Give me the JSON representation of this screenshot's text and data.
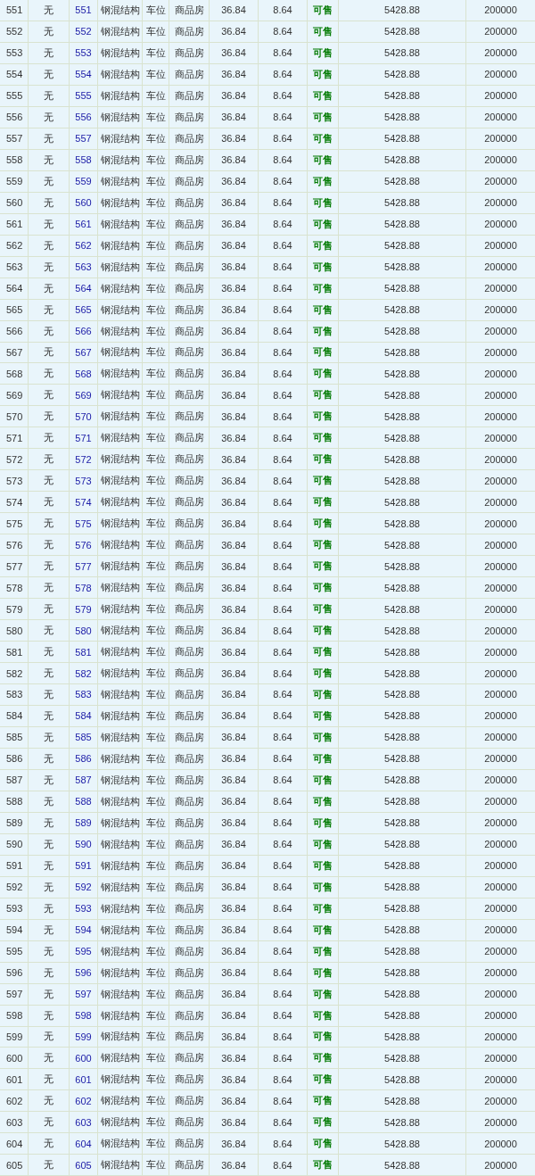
{
  "table": {
    "rows": [
      [
        "551",
        "无",
        "551",
        "钢混结构",
        "车位",
        "商品房",
        "36.84",
        "8.64",
        "可售",
        "5428.88",
        "200000"
      ],
      [
        "552",
        "无",
        "552",
        "钢混结构",
        "车位",
        "商品房",
        "36.84",
        "8.64",
        "可售",
        "5428.88",
        "200000"
      ],
      [
        "553",
        "无",
        "553",
        "钢混结构",
        "车位",
        "商品房",
        "36.84",
        "8.64",
        "可售",
        "5428.88",
        "200000"
      ],
      [
        "554",
        "无",
        "554",
        "钢混结构",
        "车位",
        "商品房",
        "36.84",
        "8.64",
        "可售",
        "5428.88",
        "200000"
      ],
      [
        "555",
        "无",
        "555",
        "钢混结构",
        "车位",
        "商品房",
        "36.84",
        "8.64",
        "可售",
        "5428.88",
        "200000"
      ],
      [
        "556",
        "无",
        "556",
        "钢混结构",
        "车位",
        "商品房",
        "36.84",
        "8.64",
        "可售",
        "5428.88",
        "200000"
      ],
      [
        "557",
        "无",
        "557",
        "钢混结构",
        "车位",
        "商品房",
        "36.84",
        "8.64",
        "可售",
        "5428.88",
        "200000"
      ],
      [
        "558",
        "无",
        "558",
        "钢混结构",
        "车位",
        "商品房",
        "36.84",
        "8.64",
        "可售",
        "5428.88",
        "200000"
      ],
      [
        "559",
        "无",
        "559",
        "钢混结构",
        "车位",
        "商品房",
        "36.84",
        "8.64",
        "可售",
        "5428.88",
        "200000"
      ],
      [
        "560",
        "无",
        "560",
        "钢混结构",
        "车位",
        "商品房",
        "36.84",
        "8.64",
        "可售",
        "5428.88",
        "200000"
      ],
      [
        "561",
        "无",
        "561",
        "钢混结构",
        "车位",
        "商品房",
        "36.84",
        "8.64",
        "可售",
        "5428.88",
        "200000"
      ],
      [
        "562",
        "无",
        "562",
        "钢混结构",
        "车位",
        "商品房",
        "36.84",
        "8.64",
        "可售",
        "5428.88",
        "200000"
      ],
      [
        "563",
        "无",
        "563",
        "钢混结构",
        "车位",
        "商品房",
        "36.84",
        "8.64",
        "可售",
        "5428.88",
        "200000"
      ],
      [
        "564",
        "无",
        "564",
        "钢混结构",
        "车位",
        "商品房",
        "36.84",
        "8.64",
        "可售",
        "5428.88",
        "200000"
      ],
      [
        "565",
        "无",
        "565",
        "钢混结构",
        "车位",
        "商品房",
        "36.84",
        "8.64",
        "可售",
        "5428.88",
        "200000"
      ],
      [
        "566",
        "无",
        "566",
        "钢混结构",
        "车位",
        "商品房",
        "36.84",
        "8.64",
        "可售",
        "5428.88",
        "200000"
      ],
      [
        "567",
        "无",
        "567",
        "钢混结构",
        "车位",
        "商品房",
        "36.84",
        "8.64",
        "可售",
        "5428.88",
        "200000"
      ],
      [
        "568",
        "无",
        "568",
        "钢混结构",
        "车位",
        "商品房",
        "36.84",
        "8.64",
        "可售",
        "5428.88",
        "200000"
      ],
      [
        "569",
        "无",
        "569",
        "钢混结构",
        "车位",
        "商品房",
        "36.84",
        "8.64",
        "可售",
        "5428.88",
        "200000"
      ],
      [
        "570",
        "无",
        "570",
        "钢混结构",
        "车位",
        "商品房",
        "36.84",
        "8.64",
        "可售",
        "5428.88",
        "200000"
      ],
      [
        "571",
        "无",
        "571",
        "钢混结构",
        "车位",
        "商品房",
        "36.84",
        "8.64",
        "可售",
        "5428.88",
        "200000"
      ],
      [
        "572",
        "无",
        "572",
        "钢混结构",
        "车位",
        "商品房",
        "36.84",
        "8.64",
        "可售",
        "5428.88",
        "200000"
      ],
      [
        "573",
        "无",
        "573",
        "钢混结构",
        "车位",
        "商品房",
        "36.84",
        "8.64",
        "可售",
        "5428.88",
        "200000"
      ],
      [
        "574",
        "无",
        "574",
        "钢混结构",
        "车位",
        "商品房",
        "36.84",
        "8.64",
        "可售",
        "5428.88",
        "200000"
      ],
      [
        "575",
        "无",
        "575",
        "钢混结构",
        "车位",
        "商品房",
        "36.84",
        "8.64",
        "可售",
        "5428.88",
        "200000"
      ],
      [
        "576",
        "无",
        "576",
        "钢混结构",
        "车位",
        "商品房",
        "36.84",
        "8.64",
        "可售",
        "5428.88",
        "200000"
      ],
      [
        "577",
        "无",
        "577",
        "钢混结构",
        "车位",
        "商品房",
        "36.84",
        "8.64",
        "可售",
        "5428.88",
        "200000"
      ],
      [
        "578",
        "无",
        "578",
        "钢混结构",
        "车位",
        "商品房",
        "36.84",
        "8.64",
        "可售",
        "5428.88",
        "200000"
      ],
      [
        "579",
        "无",
        "579",
        "钢混结构",
        "车位",
        "商品房",
        "36.84",
        "8.64",
        "可售",
        "5428.88",
        "200000"
      ],
      [
        "580",
        "无",
        "580",
        "钢混结构",
        "车位",
        "商品房",
        "36.84",
        "8.64",
        "可售",
        "5428.88",
        "200000"
      ],
      [
        "581",
        "无",
        "581",
        "钢混结构",
        "车位",
        "商品房",
        "36.84",
        "8.64",
        "可售",
        "5428.88",
        "200000"
      ],
      [
        "582",
        "无",
        "582",
        "钢混结构",
        "车位",
        "商品房",
        "36.84",
        "8.64",
        "可售",
        "5428.88",
        "200000"
      ],
      [
        "583",
        "无",
        "583",
        "钢混结构",
        "车位",
        "商品房",
        "36.84",
        "8.64",
        "可售",
        "5428.88",
        "200000"
      ],
      [
        "584",
        "无",
        "584",
        "钢混结构",
        "车位",
        "商品房",
        "36.84",
        "8.64",
        "可售",
        "5428.88",
        "200000"
      ],
      [
        "585",
        "无",
        "585",
        "钢混结构",
        "车位",
        "商品房",
        "36.84",
        "8.64",
        "可售",
        "5428.88",
        "200000"
      ],
      [
        "586",
        "无",
        "586",
        "钢混结构",
        "车位",
        "商品房",
        "36.84",
        "8.64",
        "可售",
        "5428.88",
        "200000"
      ],
      [
        "587",
        "无",
        "587",
        "钢混结构",
        "车位",
        "商品房",
        "36.84",
        "8.64",
        "可售",
        "5428.88",
        "200000"
      ],
      [
        "588",
        "无",
        "588",
        "钢混结构",
        "车位",
        "商品房",
        "36.84",
        "8.64",
        "可售",
        "5428.88",
        "200000"
      ],
      [
        "589",
        "无",
        "589",
        "钢混结构",
        "车位",
        "商品房",
        "36.84",
        "8.64",
        "可售",
        "5428.88",
        "200000"
      ],
      [
        "590",
        "无",
        "590",
        "钢混结构",
        "车位",
        "商品房",
        "36.84",
        "8.64",
        "可售",
        "5428.88",
        "200000"
      ],
      [
        "591",
        "无",
        "591",
        "钢混结构",
        "车位",
        "商品房",
        "36.84",
        "8.64",
        "可售",
        "5428.88",
        "200000"
      ],
      [
        "592",
        "无",
        "592",
        "钢混结构",
        "车位",
        "商品房",
        "36.84",
        "8.64",
        "可售",
        "5428.88",
        "200000"
      ],
      [
        "593",
        "无",
        "593",
        "钢混结构",
        "车位",
        "商品房",
        "36.84",
        "8.64",
        "可售",
        "5428.88",
        "200000"
      ],
      [
        "594",
        "无",
        "594",
        "钢混结构",
        "车位",
        "商品房",
        "36.84",
        "8.64",
        "可售",
        "5428.88",
        "200000"
      ],
      [
        "595",
        "无",
        "595",
        "钢混结构",
        "车位",
        "商品房",
        "36.84",
        "8.64",
        "可售",
        "5428.88",
        "200000"
      ],
      [
        "596",
        "无",
        "596",
        "钢混结构",
        "车位",
        "商品房",
        "36.84",
        "8.64",
        "可售",
        "5428.88",
        "200000"
      ],
      [
        "597",
        "无",
        "597",
        "钢混结构",
        "车位",
        "商品房",
        "36.84",
        "8.64",
        "可售",
        "5428.88",
        "200000"
      ],
      [
        "598",
        "无",
        "598",
        "钢混结构",
        "车位",
        "商品房",
        "36.84",
        "8.64",
        "可售",
        "5428.88",
        "200000"
      ],
      [
        "599",
        "无",
        "599",
        "钢混结构",
        "车位",
        "商品房",
        "36.84",
        "8.64",
        "可售",
        "5428.88",
        "200000"
      ],
      [
        "600",
        "无",
        "600",
        "钢混结构",
        "车位",
        "商品房",
        "36.84",
        "8.64",
        "可售",
        "5428.88",
        "200000"
      ],
      [
        "601",
        "无",
        "601",
        "钢混结构",
        "车位",
        "商品房",
        "36.84",
        "8.64",
        "可售",
        "5428.88",
        "200000"
      ],
      [
        "602",
        "无",
        "602",
        "钢混结构",
        "车位",
        "商品房",
        "36.84",
        "8.64",
        "可售",
        "5428.88",
        "200000"
      ],
      [
        "603",
        "无",
        "603",
        "钢混结构",
        "车位",
        "商品房",
        "36.84",
        "8.64",
        "可售",
        "5428.88",
        "200000"
      ],
      [
        "604",
        "无",
        "604",
        "钢混结构",
        "车位",
        "商品房",
        "36.84",
        "8.64",
        "可售",
        "5428.88",
        "200000"
      ],
      [
        "605",
        "无",
        "605",
        "钢混结构",
        "车位",
        "商品房",
        "36.84",
        "8.64",
        "可售",
        "5428.88",
        "200000"
      ]
    ]
  }
}
